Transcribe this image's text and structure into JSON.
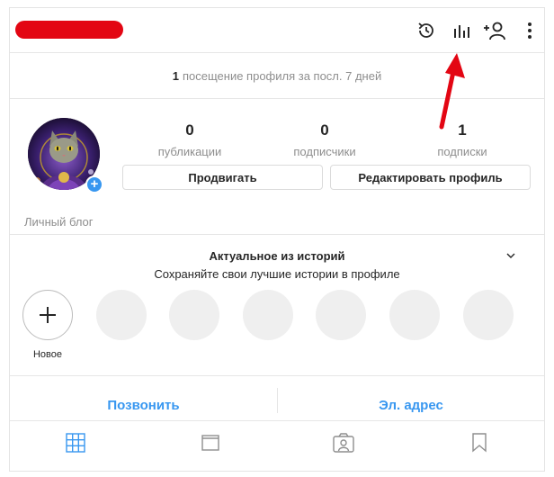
{
  "header": {
    "icons": [
      "history-icon",
      "insights-icon",
      "add-person-icon",
      "more-menu-icon"
    ]
  },
  "visits": {
    "count": "1",
    "text": "посещение профиля за посл. 7 дней"
  },
  "stats": [
    {
      "value": "0",
      "label": "публикации"
    },
    {
      "value": "0",
      "label": "подписчики"
    },
    {
      "value": "1",
      "label": "подписки"
    }
  ],
  "buttons": {
    "promote": "Продвигать",
    "edit_profile": "Редактировать профиль"
  },
  "bio": {
    "category": "Личный блог"
  },
  "highlights": {
    "title": "Актуальное из историй",
    "subtitle": "Сохраняйте свои лучшие истории в профиле",
    "new_label": "Новое"
  },
  "contact": {
    "call": "Позвонить",
    "email": "Эл. адрес"
  },
  "tabs": [
    "grid-icon",
    "feed-icon",
    "tagged-icon",
    "saved-icon"
  ],
  "colors": {
    "accent_blue": "#3897f0",
    "annotation_red": "#e30613",
    "muted_text": "#8e8e8e"
  }
}
